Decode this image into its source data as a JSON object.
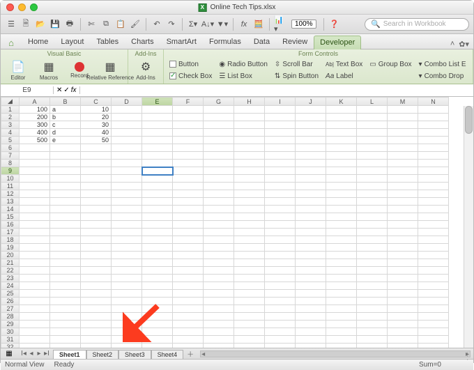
{
  "window": {
    "title": "Online Tech Tips.xlsx"
  },
  "quickbar": {
    "zoom": "100%",
    "search_placeholder": "Search in Workbook"
  },
  "ribbon_tabs": {
    "items": [
      "Home",
      "Layout",
      "Tables",
      "Charts",
      "SmartArt",
      "Formulas",
      "Data",
      "Review",
      "Developer"
    ],
    "active": 8
  },
  "ribbon": {
    "groups": {
      "vb": {
        "title": "Visual Basic",
        "editor": "Editor",
        "macros": "Macros",
        "record": "Record",
        "relref": "Relative Reference"
      },
      "addins": {
        "title": "Add-Ins",
        "addins": "Add-Ins"
      },
      "form": {
        "title": "Form Controls",
        "button": "Button",
        "radio": "Radio Button",
        "scroll": "Scroll Bar",
        "text": "Text Box",
        "group": "Group Box",
        "combol": "Combo List E",
        "check": "Check Box",
        "list": "List Box",
        "spin": "Spin Button",
        "label": "Label",
        "combod": "Combo Drop"
      }
    }
  },
  "formula_bar": {
    "cellref": "E9",
    "value": ""
  },
  "sheet": {
    "columns": [
      "A",
      "B",
      "C",
      "D",
      "E",
      "F",
      "G",
      "H",
      "I",
      "J",
      "K",
      "L",
      "M",
      "N"
    ],
    "row_count": 33,
    "active_cell": {
      "row": 9,
      "col": 4
    },
    "data": {
      "1": {
        "A": "100",
        "B": "a",
        "C": "10"
      },
      "2": {
        "A": "200",
        "B": "b",
        "C": "20"
      },
      "3": {
        "A": "300",
        "B": "c",
        "C": "30"
      },
      "4": {
        "A": "400",
        "B": "d",
        "C": "40"
      },
      "5": {
        "A": "500",
        "B": "e",
        "C": "50"
      }
    }
  },
  "sheets_bar": {
    "tabs": [
      "Sheet1",
      "Sheet2",
      "Sheet3",
      "Sheet4"
    ],
    "active": 0
  },
  "status": {
    "view": "Normal View",
    "state": "Ready",
    "sum": "Sum=0"
  }
}
